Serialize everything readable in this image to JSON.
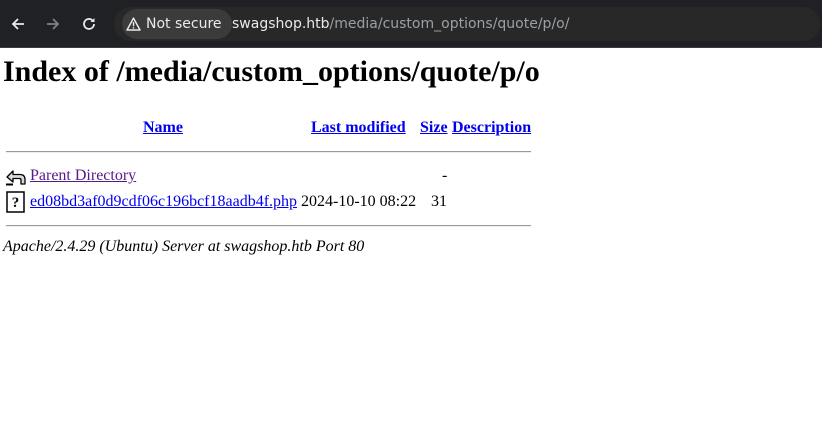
{
  "browser": {
    "security_label": "Not secure",
    "url_host": "swagshop.htb",
    "url_path": "/media/custom_options/quote/p/o/"
  },
  "page": {
    "title": "Index of /media/custom_options/quote/p/o",
    "columns": {
      "name": "Name",
      "last_modified": "Last modified",
      "size": "Size",
      "description": "Description"
    },
    "rows": [
      {
        "name": "Parent Directory",
        "last_modified": "",
        "size": "-",
        "description": "",
        "icon": "back-icon"
      },
      {
        "name": "ed08bd3af0d9cdf06c196bcf18aadb4f.php",
        "last_modified": "2024-10-10 08:22",
        "size": "31",
        "description": "",
        "icon": "unknown-file-icon"
      }
    ],
    "address": "Apache/2.4.29 (Ubuntu) Server at swagshop.htb Port 80"
  }
}
